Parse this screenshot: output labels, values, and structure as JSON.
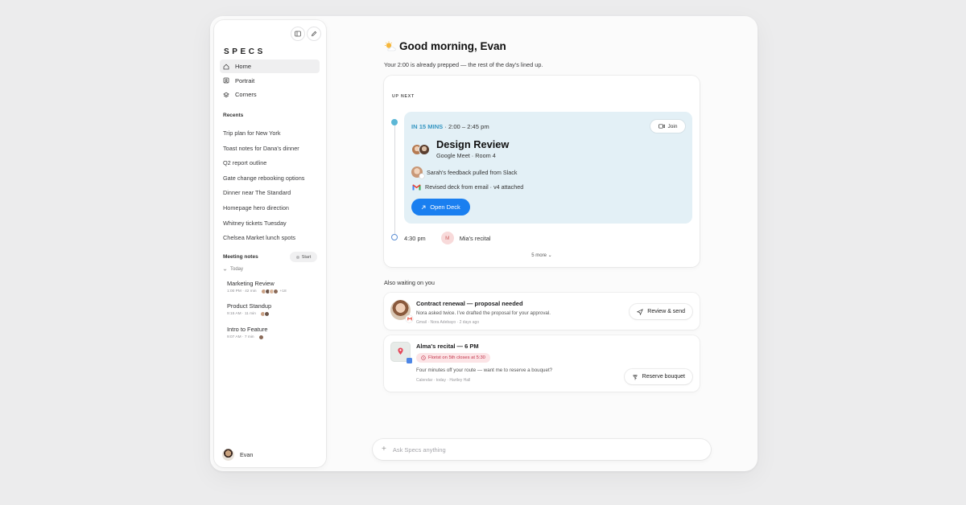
{
  "sidebar": {
    "logo": "SPECS",
    "nav": [
      {
        "label": "Home",
        "icon": "home-icon"
      },
      {
        "label": "Portrait",
        "icon": "portrait-icon"
      },
      {
        "label": "Corners",
        "icon": "layers-icon"
      }
    ],
    "recents_label": "Recents",
    "recents": [
      "Trip plan for New York",
      "Toast notes for Dana's dinner",
      "Q2 report outline",
      "Gate change rebooking options",
      "Dinner near The Standard",
      "Homepage hero direction",
      "Whitney tickets Tuesday",
      "Chelsea Market lunch spots"
    ],
    "meeting_notes_label": "Meeting notes",
    "start_label": "Start",
    "today_label": "Today",
    "notes": [
      {
        "title": "Marketing Review",
        "meta": "1:00 PM · 42 min",
        "extra": "+18"
      },
      {
        "title": "Product Standup",
        "meta": "9:15 AM · 11 min",
        "extra": ""
      },
      {
        "title": "Intro to Feature",
        "meta": "9:07 AM · 7 min",
        "extra": ""
      }
    ],
    "user_name": "Evan"
  },
  "main": {
    "greeting": "Good morning, Evan",
    "subtitle": "Your 2:00 is already prepped — the rest of the day's lined up.",
    "up_next_label": "UP NEXT",
    "event": {
      "soon": "IN 15 MINS",
      "time": " · 2:00 – 2:45 pm",
      "join_label": "Join",
      "title": "Design Review",
      "location": "Google Meet · Room 4",
      "prep_1": "Sarah's feedback pulled from Slack",
      "prep_2": "Revised deck from email · v4 attached",
      "open_label": "Open Deck"
    },
    "later": {
      "time": "4:30 pm",
      "initial": "M",
      "title": "Mia's recital"
    },
    "more_label": "5 more",
    "also_label": "Also waiting on you",
    "tasks": [
      {
        "title": "Contract renewal — proposal needed",
        "desc": "Nora asked twice. I've drafted the proposal for your approval.",
        "meta": "Gmail · Nora Adebayo · 2 days ago",
        "button": "Review & send"
      },
      {
        "title": "Alma's recital — 6 PM",
        "pill": "Florist on 5th closes at 5:30",
        "desc": "Four minutes off your route — want me to reserve a bouquet?",
        "meta": "Calendar · today · Hartley Hall",
        "button": "Reserve bouquet"
      }
    ],
    "ask_placeholder": "Ask Specs anything"
  },
  "colors": {
    "accent": "#1a7ff0",
    "event_bg": "#e3f0f6",
    "soon_text": "#3596c2",
    "pill_bg": "#fce4e6",
    "pill_text": "#c2334a"
  }
}
